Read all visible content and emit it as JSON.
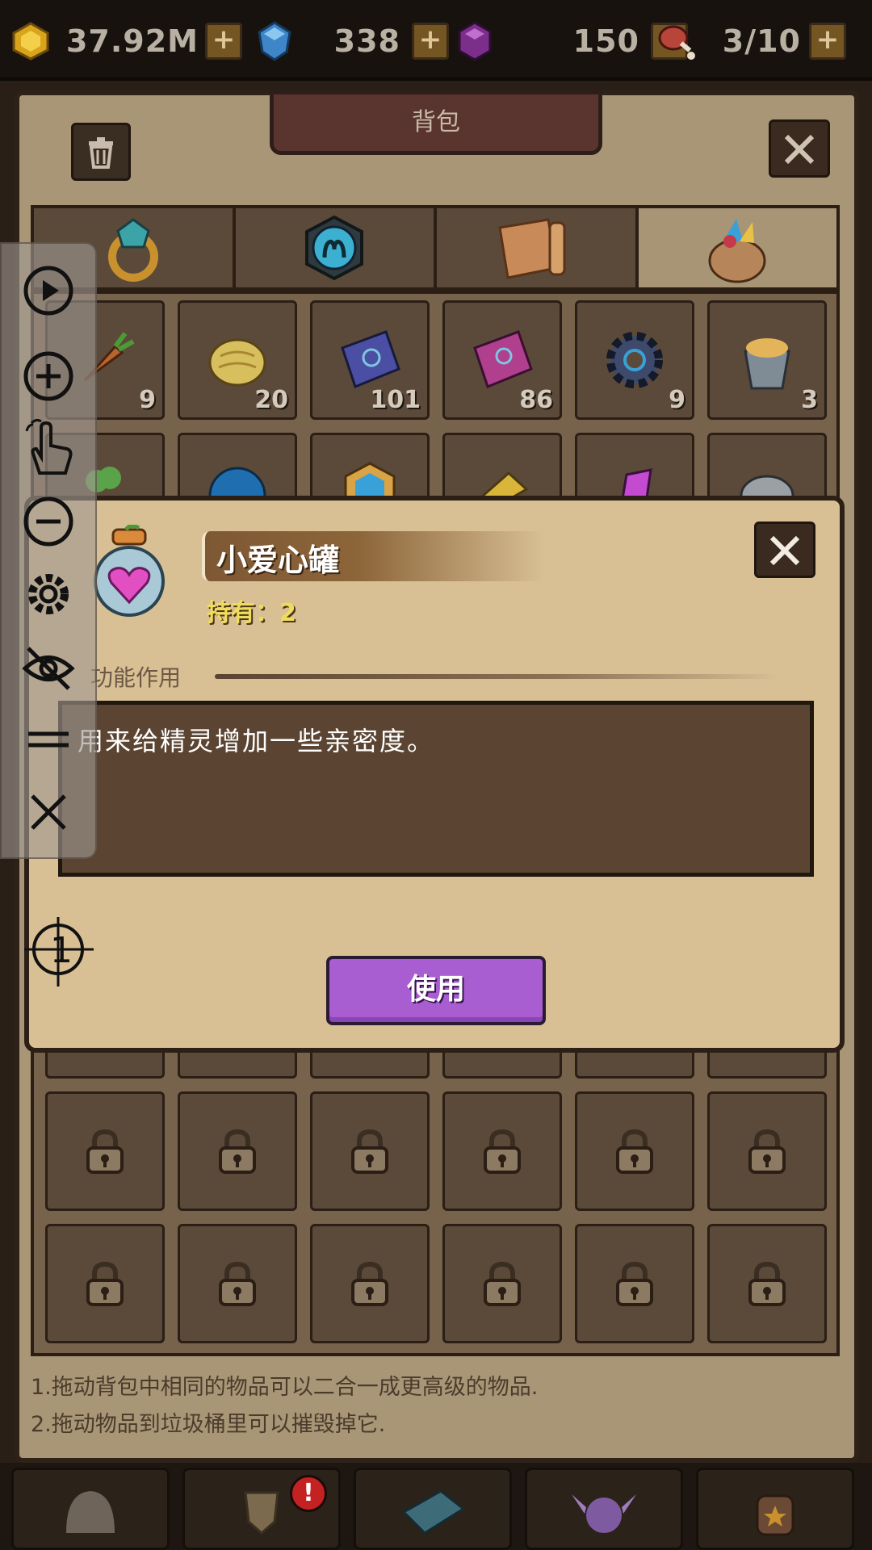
{
  "resources": [
    {
      "name": "gold",
      "icon": "gold-coin-icon",
      "value": "37.92M"
    },
    {
      "name": "diamond",
      "icon": "blue-gem-icon",
      "value": "338"
    },
    {
      "name": "crystal",
      "icon": "purple-gem-icon",
      "value": "150"
    },
    {
      "name": "stamina",
      "icon": "meat-icon",
      "value": "3/10"
    }
  ],
  "plus_label": "+",
  "panel": {
    "title": "背包",
    "tabs": [
      "ring-icon",
      "zodiac-aries-icon",
      "map-scroll-icon",
      "bag-icon"
    ],
    "row1_counts": [
      "9",
      "20",
      "101",
      "86",
      "9",
      "3"
    ],
    "tips": [
      "1.拖动背包中相同的物品可以二合一成更高级的物品.",
      "2.拖动物品到垃圾桶里可以摧毁掉它."
    ]
  },
  "popup": {
    "item_name": "小爱心罐",
    "own_label": "持有：",
    "own_value": "2",
    "section_label": "功能作用",
    "description": "用来给精灵增加一些亲密度。",
    "use_button": "使用"
  },
  "bottom_nav": {
    "badge": "!"
  },
  "colors": {
    "panel": "#a99676",
    "popup": "#d8bf94",
    "use_button": "#a85ed0",
    "own_text": "#f0dc5c"
  }
}
